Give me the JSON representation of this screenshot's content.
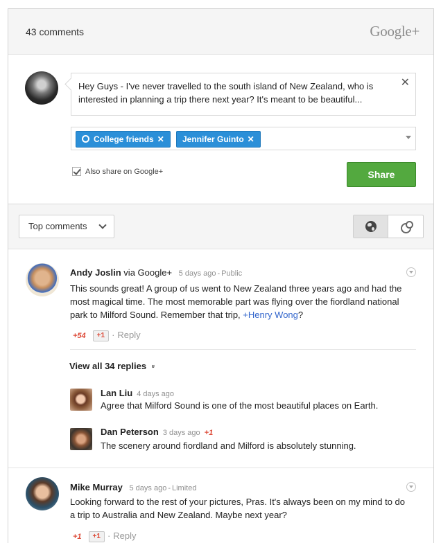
{
  "header": {
    "comment_count": "43 comments",
    "brand": "Google+"
  },
  "compose": {
    "text": "Hey Guys - I've never travelled to the south island of New Zealand, who is interested in planning a trip there next year? It's meant to be beautiful...",
    "close_glyph": "✕",
    "chips": [
      {
        "label": "College friends",
        "remove": "✕"
      },
      {
        "label": "Jennifer Guinto",
        "remove": "✕"
      }
    ],
    "also_share_label": "Also share on Google+",
    "share_label": "Share"
  },
  "toolbar": {
    "sort_label": "Top comments",
    "view_icons": [
      "globe-icon",
      "circles-icon"
    ]
  },
  "comments": [
    {
      "author": "Andy Joslin",
      "via": " via Google+",
      "time": "5 days ago",
      "visibility": "Public",
      "text_before": "This sounds great! A group of us went to New Zealand three years ago and had the most magical time. The most memorable part was flying over the fiordland national park to Milford Sound. Remember that trip, ",
      "mention": "+Henry Wong",
      "text_after": "?",
      "plus_count": "+54",
      "plus_button": "+1",
      "reply": "Reply"
    },
    {
      "author": "Mike Murray",
      "time": "5 days ago",
      "visibility": "Limited",
      "text": "Looking forward to the rest of your pictures, Pras. It's always been on my mind to do a trip to Australia and New Zealand. Maybe next year?",
      "plus_count": "+1",
      "plus_button": "+1",
      "reply": "Reply"
    }
  ],
  "replies": {
    "view_all_label": "View all 34 replies",
    "view_all_chevron": "»",
    "items": [
      {
        "author": "Lan Liu",
        "time": "4 days ago",
        "text": "Agree that Milford Sound is one of the most beautiful places on Earth."
      },
      {
        "author": "Dan Peterson",
        "time": "3 days ago",
        "plus": "+1",
        "text": "The scenery around fiordland and Milford is absolutely stunning."
      }
    ]
  },
  "separators": {
    "meta_dash": "-",
    "dot": "·"
  }
}
